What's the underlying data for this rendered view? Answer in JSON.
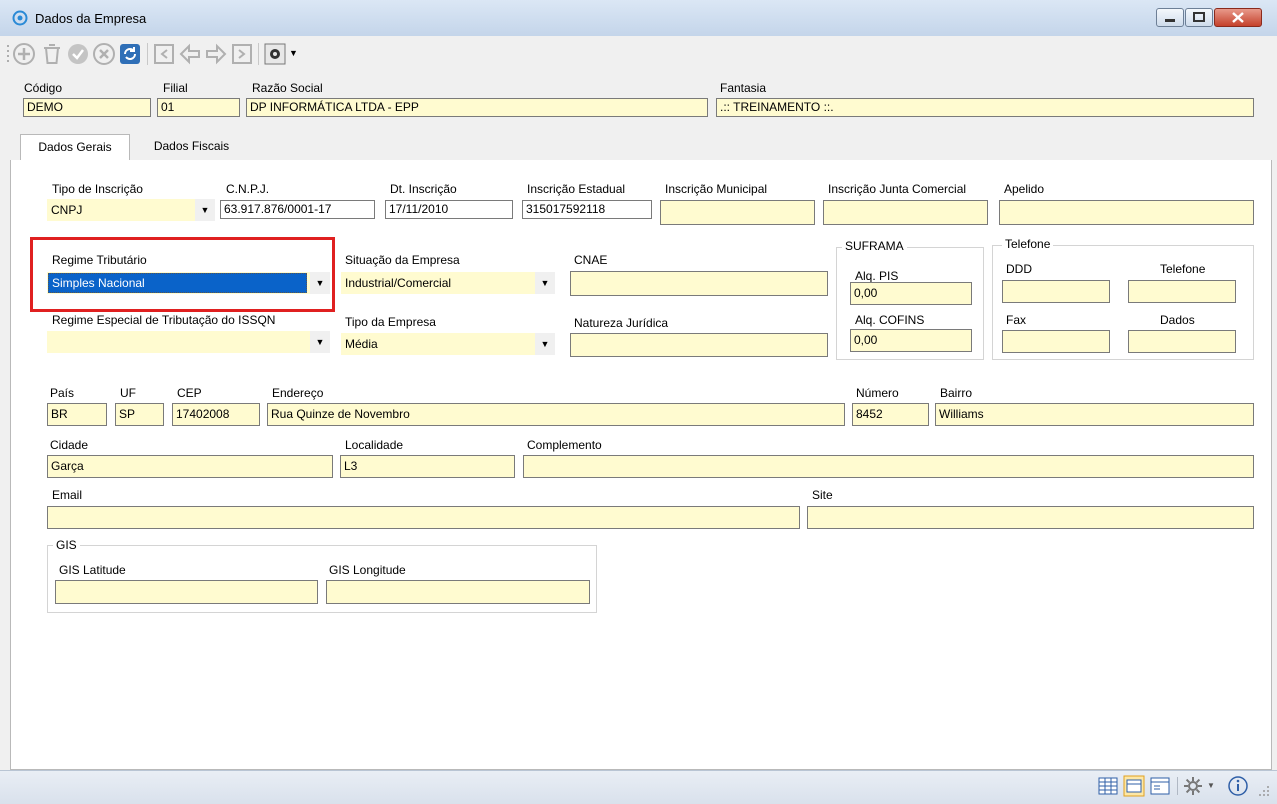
{
  "window": {
    "title": "Dados da Empresa",
    "accent_color": "#0a63c9",
    "highlight_color": "#e02020",
    "field_color": "#fffbd0"
  },
  "toolbar": {
    "icons": [
      "add-icon",
      "delete-icon",
      "confirm-icon",
      "cancel-icon",
      "refresh-icon",
      "first-icon",
      "previous-icon",
      "next-icon",
      "last-icon",
      "settings-icon"
    ]
  },
  "header": {
    "codigo": {
      "label": "Código",
      "value": "DEMO"
    },
    "filial": {
      "label": "Filial",
      "value": "01"
    },
    "razao_social": {
      "label": "Razão Social",
      "value": "DP INFORMÁTICA LTDA - EPP"
    },
    "fantasia": {
      "label": "Fantasia",
      "value": ".:: TREINAMENTO ::."
    }
  },
  "tabs": [
    {
      "label": "Dados Gerais",
      "active": true
    },
    {
      "label": "Dados Fiscais",
      "active": false
    }
  ],
  "form": {
    "tipo_inscricao": {
      "label": "Tipo de Inscrição",
      "value": "CNPJ"
    },
    "cnpj": {
      "label": "C.N.P.J.",
      "value": "63.917.876/0001-17"
    },
    "dt_inscricao": {
      "label": "Dt. Inscrição",
      "value": "17/11/2010"
    },
    "inscricao_estadual": {
      "label": "Inscrição Estadual",
      "value": "315017592118"
    },
    "inscricao_municipal": {
      "label": "Inscrição Municipal",
      "value": ""
    },
    "inscricao_junta": {
      "label": "Inscrição Junta Comercial",
      "value": ""
    },
    "apelido": {
      "label": "Apelido",
      "value": ""
    },
    "regime_tributario": {
      "label": "Regime Tributário",
      "value": "Simples Nacional"
    },
    "situacao_empresa": {
      "label": "Situação da Empresa",
      "value": "Industrial/Comercial"
    },
    "cnae": {
      "label": "CNAE",
      "value": ""
    },
    "regime_especial": {
      "label": "Regime Especial de Tributação do ISSQN",
      "value": ""
    },
    "tipo_empresa": {
      "label": "Tipo da Empresa",
      "value": "Média"
    },
    "natureza_juridica": {
      "label": "Natureza Jurídica",
      "value": ""
    },
    "suframa": {
      "title": "SUFRAMA",
      "aliq_pis": {
        "label": "Alq. PIS",
        "value": "0,00"
      },
      "aliq_cofins": {
        "label": "Alq. COFINS",
        "value": "0,00"
      }
    },
    "telefone_group": {
      "title": "Telefone",
      "ddd": {
        "label": "DDD",
        "value": ""
      },
      "telefone": {
        "label": "Telefone",
        "value": ""
      },
      "fax": {
        "label": "Fax",
        "value": ""
      },
      "dados": {
        "label": "Dados",
        "value": ""
      }
    },
    "pais": {
      "label": "País",
      "value": "BR"
    },
    "uf": {
      "label": "UF",
      "value": "SP"
    },
    "cep": {
      "label": "CEP",
      "value": "17402008"
    },
    "endereco": {
      "label": "Endereço",
      "value": "Rua Quinze de Novembro"
    },
    "numero": {
      "label": "Número",
      "value": "8452"
    },
    "bairro": {
      "label": "Bairro",
      "value": "Williams"
    },
    "cidade": {
      "label": "Cidade",
      "value": "Garça"
    },
    "localidade": {
      "label": "Localidade",
      "value": "L3"
    },
    "complemento": {
      "label": "Complemento",
      "value": ""
    },
    "email": {
      "label": "Email",
      "value": ""
    },
    "site": {
      "label": "Site",
      "value": ""
    },
    "gis": {
      "title": "GIS",
      "latitude": {
        "label": "GIS Latitude",
        "value": ""
      },
      "longitude": {
        "label": "GIS Longitude",
        "value": ""
      }
    }
  },
  "statusbar": {
    "icons": [
      "grid-view-icon",
      "form-view-icon",
      "card-view-icon",
      "settings-icon",
      "info-icon"
    ]
  }
}
